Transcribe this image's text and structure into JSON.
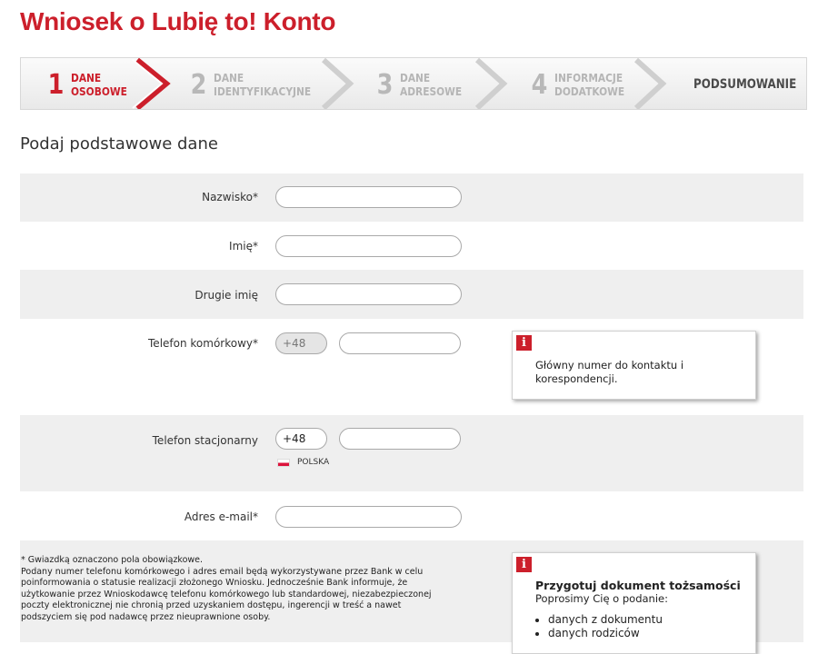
{
  "page": {
    "title": "Wniosek o Lubię to! Konto"
  },
  "stepper": {
    "steps": [
      {
        "number": "1",
        "line1": "DANE",
        "line2": "OSOBOWE",
        "active": true
      },
      {
        "number": "2",
        "line1": "DANE",
        "line2": "IDENTYFIKACYJNE",
        "active": false
      },
      {
        "number": "3",
        "line1": "DANE",
        "line2": "ADRESOWE",
        "active": false
      },
      {
        "number": "4",
        "line1": "INFORMACJE",
        "line2": "DODATKOWE",
        "active": false
      }
    ],
    "summary_label": "PODSUMOWANIE",
    "active_color": "#cc1f2b",
    "inactive_color": "#b8b8b8"
  },
  "form": {
    "section_title": "Podaj podstawowe dane",
    "fields": {
      "surname": {
        "label": "Nazwisko*",
        "value": ""
      },
      "first_name": {
        "label": "Imię*",
        "value": ""
      },
      "second_name": {
        "label": "Drugie imię",
        "value": ""
      },
      "mobile": {
        "label": "Telefon komórkowy*",
        "prefix": "+48",
        "value": ""
      },
      "landline": {
        "label": "Telefon stacjonarny",
        "prefix": "+48",
        "value": "",
        "country": "POLSKA"
      },
      "email": {
        "label": "Adres e-mail*",
        "value": ""
      }
    },
    "row_shade_color": "#efefef"
  },
  "info_mobile": {
    "text": "Główny numer do kontaktu i korespondencji."
  },
  "footnote": {
    "line1": "* Gwiazdką oznaczono pola obowiązkowe.",
    "line2": "Podany numer telefonu komórkowego i adres email będą wykorzystywane przez Bank w celu poinformowania o statusie realizacji złożonego Wniosku. Jednocześnie Bank informuje, że użytkowanie przez Wnioskodawcę telefonu komórkowego lub standardowej, niezabezpieczonej poczty elektronicznej nie chronią przed uzyskaniem dostępu, ingerencji w treść a nawet podszyciem się pod nadawcę przez nieuprawnione osoby."
  },
  "info_document": {
    "title": "Przygotuj dokument tożsamości",
    "subtitle": "Poprosimy Cię o podanie:",
    "items": [
      "danych z dokumentu",
      "danych rodziców"
    ]
  },
  "brand_color": "#cc1f2b"
}
